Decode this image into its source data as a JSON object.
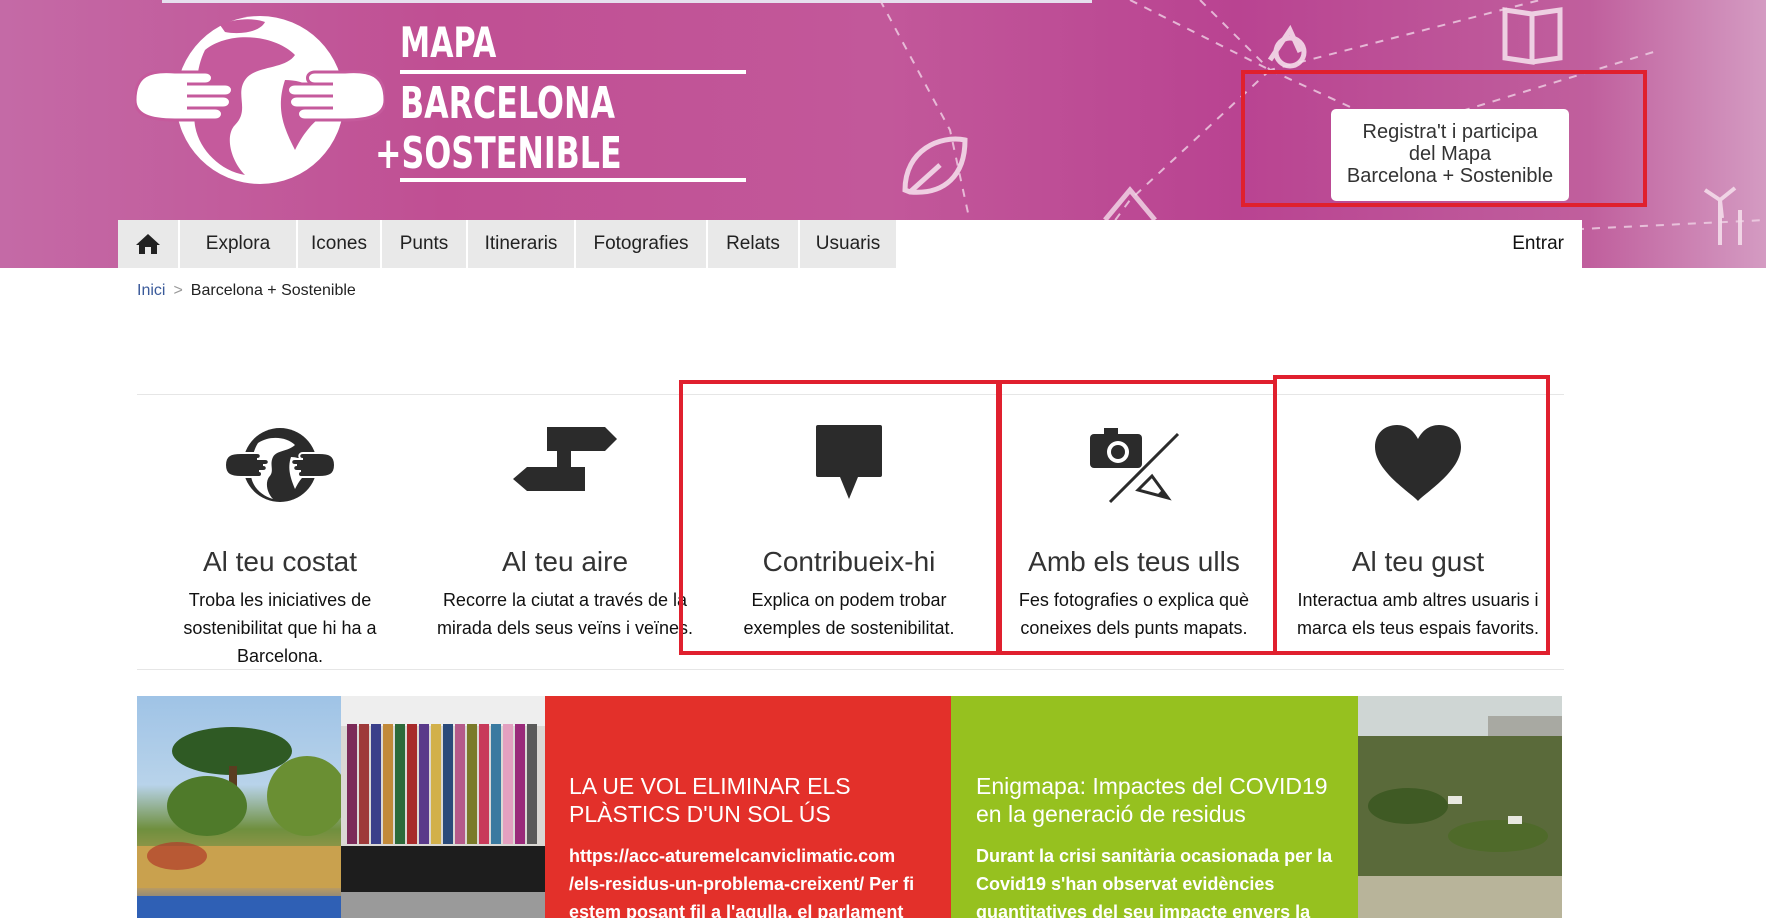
{
  "brand": {
    "line1": "MAPA",
    "line2": "BARCELONA",
    "line3": "+SOSTENIBLE",
    "primary_color": "#c04f93"
  },
  "cta": {
    "line1": "Registra't i participa",
    "line2": "del Mapa",
    "line3": "Barcelona + Sostenible"
  },
  "nav": {
    "home_icon": "home-icon",
    "items": [
      "Explora",
      "Icones",
      "Punts",
      "Itineraris",
      "Fotografies",
      "Relats",
      "Usuaris"
    ],
    "login": "Entrar"
  },
  "breadcrumb": {
    "home": "Inici",
    "separator": ">",
    "current": "Barcelona + Sostenible"
  },
  "features": [
    {
      "icon": "globe-hands-icon",
      "title": "Al teu costat",
      "desc": "Troba les iniciatives de sostenibilitat que hi ha a Barcelona."
    },
    {
      "icon": "signpost-icon",
      "title": "Al teu aire",
      "desc": "Recorre la ciutat a través de la mirada dels seus veïns i veïnes."
    },
    {
      "icon": "speech-bubble-icon",
      "title": "Contribueix-hi",
      "desc": "Explica on podem trobar exemples de sostenibilitat."
    },
    {
      "icon": "camera-pencil-icon",
      "title": "Amb els teus ulls",
      "desc": "Fes fotografies o explica què coneixes dels punts mapats."
    },
    {
      "icon": "heart-icon",
      "title": "Al teu gust",
      "desc": "Interactua amb altres usuaris i marca els teus espais favorits."
    }
  ],
  "tiles": {
    "red": {
      "color": "#e3302a",
      "title": "LA UE VOL ELIMINAR ELS PLÀSTICS D'UN SOL ÚS",
      "body": "https://acc-aturemelcanviclimatic.com /els-residus-un-problema-creixent/ Per fi estem posant fil a l'agulla, el parlament de"
    },
    "green": {
      "color": "#96c11f",
      "title": "Enigmapa: Impactes del COVID19 en la generació de residus",
      "body": "Durant la crisi sanitària ocasionada per la Covid19 s'han observat evidències quantitatives del seu impacte envers la"
    }
  },
  "highlight_color": "#e0202e"
}
